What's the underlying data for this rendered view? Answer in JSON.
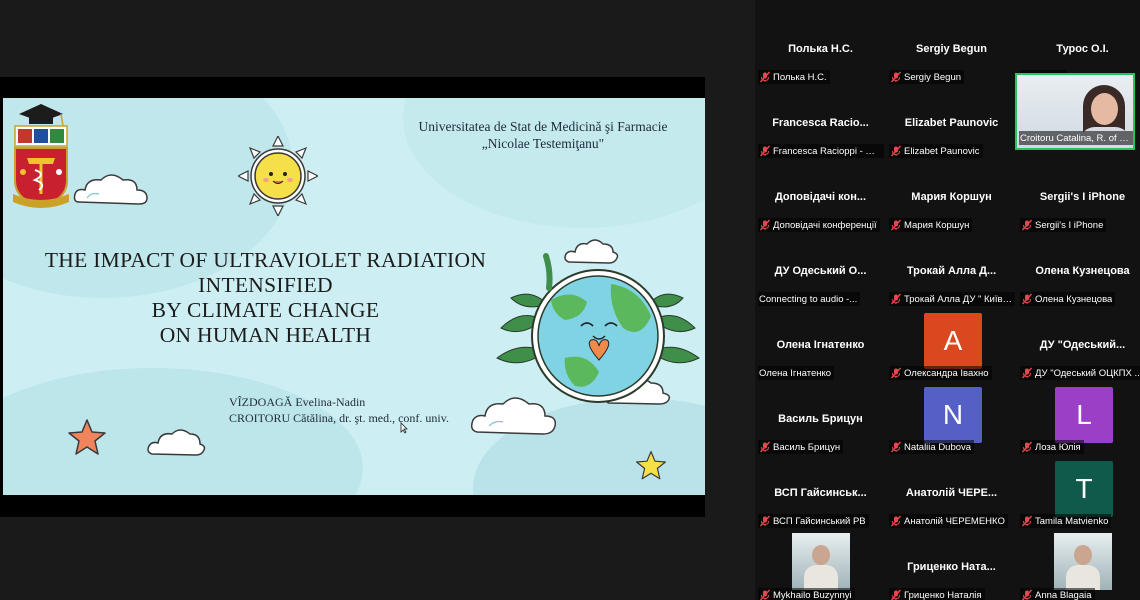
{
  "slide": {
    "university_line1": "Universitatea  de Stat de Medicină şi Farmacie",
    "university_line2": "„Nicolae Testemiţanu\"",
    "title_lines": [
      "THE IMPACT OF ULTRAVIOLET RADIATION",
      "INTENSIFIED",
      "BY CLIMATE CHANGE",
      "ON HUMAN HEALTH"
    ],
    "author1": "VÎZDOAGĂ  Evelina-Nadin",
    "author2": "CROITORU  Cătălina, dr. şt. med., conf. univ."
  },
  "participants": [
    {
      "name": "Полька Н.С.",
      "label": "Полька Н.С.",
      "muted": true
    },
    {
      "name": "Sergiy Begun",
      "label": "Sergiy Begun",
      "muted": true
    },
    {
      "name": "Турос О.І.",
      "label": "Турос О.І.",
      "muted": false
    },
    {
      "name": "Francesca  Racio...",
      "label": "Francesca Racioppi - W...",
      "muted": true
    },
    {
      "name": "Elizabet Paunovic",
      "label": "Elizabet Paunovic",
      "muted": true
    },
    {
      "name": "Доповідачі кон...",
      "label": "Доповідачі конференції",
      "muted": true
    },
    {
      "name": "Мария Коршун",
      "label": "Мария Коршун",
      "muted": true
    },
    {
      "name": "Sergii's I iPhone",
      "label": "Sergii's I iPhone",
      "muted": true
    },
    {
      "name": "ДУ  Одеський  О...",
      "label": "Connecting to audio -...",
      "muted": false
    },
    {
      "name": "Трокай Алла Д...",
      "label": "Трокай Алла ДУ \" Київс...",
      "muted": true
    },
    {
      "name": "Олена Кузнецова",
      "label": "Олена Кузнецова",
      "muted": true
    },
    {
      "name": "Олена Ігнатенко",
      "label": "Олена Ігнатенко",
      "muted": false
    },
    {
      "name": "",
      "label": "Олександра Івахно",
      "muted": true,
      "avatar": "A",
      "avatar_color": "#d9481f"
    },
    {
      "name": "ДУ  \"Одеський...",
      "label": "ДУ \"Одеський ОЦКПХ ...",
      "muted": true
    },
    {
      "name": "Василь Брицун",
      "label": "Василь Брицун",
      "muted": true
    },
    {
      "name": "",
      "label": "Nataliia Dubova",
      "muted": true,
      "avatar": "N",
      "avatar_color": "#5460c6"
    },
    {
      "name": "",
      "label": "Лоза Юлія",
      "muted": true,
      "avatar": "L",
      "avatar_color": "#9c3fc7"
    },
    {
      "name": "ВСП  Гайсинськ...",
      "label": "ВСП Гайсинський РВ",
      "muted": true
    },
    {
      "name": "Анатолій  ЧЕРЕ...",
      "label": "Анатолій ЧЕРЕМЕНКО",
      "muted": true
    },
    {
      "name": "",
      "label": "Tamila Matvienko",
      "muted": true,
      "avatar": "T",
      "avatar_color": "#0f5a4a"
    },
    {
      "name": "",
      "label": "Mykhailo Buzynnyi",
      "muted": true,
      "photo": true
    },
    {
      "name": "Гриценко  Ната...",
      "label": "Гриценко Наталія",
      "muted": true
    },
    {
      "name": "",
      "label": "Anna Blagaia",
      "muted": true,
      "photo": true
    }
  ],
  "active_video": {
    "label": "Croitoru Catalina, R. of Mo"
  },
  "colors": {
    "panel_bg": "#121212",
    "speaker_border": "#22c55e",
    "mic_muted": "#e5484d"
  }
}
